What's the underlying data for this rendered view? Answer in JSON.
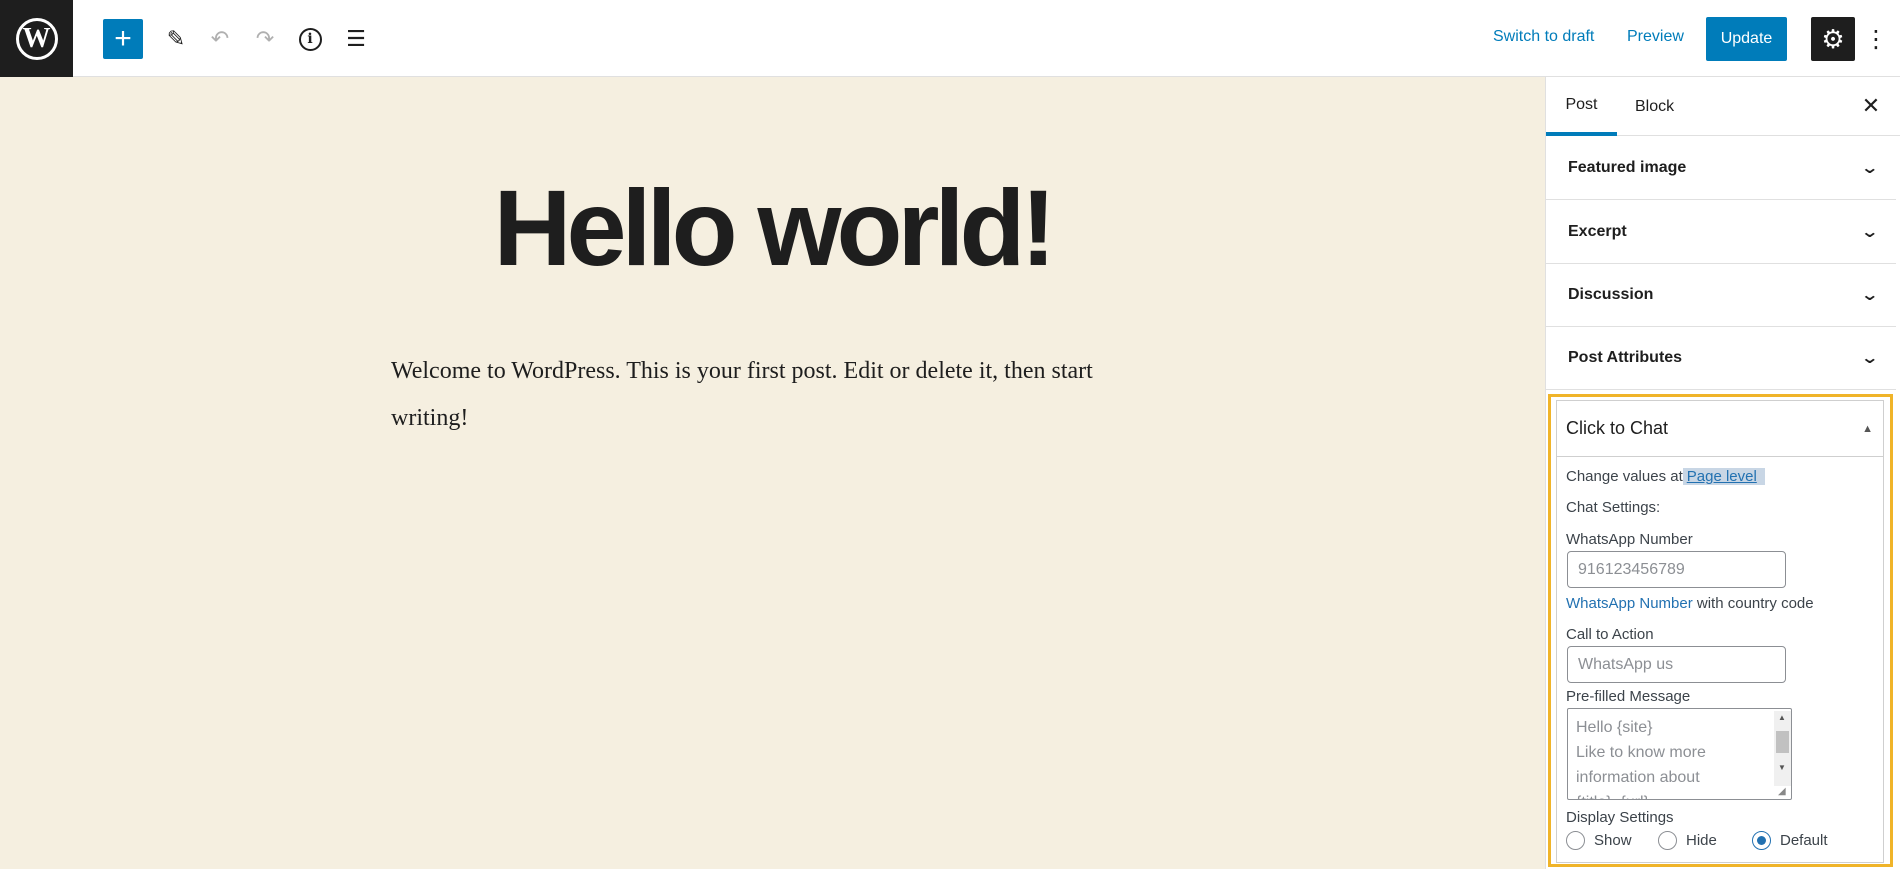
{
  "toolbar": {
    "logo_letter": "W",
    "add_icon": "+",
    "pen_icon": "✎",
    "undo_icon": "↶",
    "redo_icon": "↷",
    "info_icon": "i",
    "outline_icon": "☰",
    "switch_to_draft": "Switch to draft",
    "preview": "Preview",
    "update": "Update",
    "settings_icon": "⚙",
    "more_icon": "⋮"
  },
  "post": {
    "title": "Hello world!",
    "body": "Welcome to WordPress. This is your first post. Edit or delete it, then start writing!"
  },
  "sidebar": {
    "tabs": [
      {
        "label": "Post"
      },
      {
        "label": "Block"
      }
    ],
    "close_icon": "✕",
    "chevron": "⌄",
    "panels": [
      {
        "label": "Featured image"
      },
      {
        "label": "Excerpt"
      },
      {
        "label": "Discussion"
      },
      {
        "label": "Post Attributes"
      }
    ]
  },
  "click_to_chat": {
    "title": "Click to Chat",
    "collapse_icon": "▲",
    "change_values_prefix": "Change values at",
    "page_level_link": "Page level",
    "chat_settings_label": "Chat Settings:",
    "whatsapp_number_label": "WhatsApp Number",
    "whatsapp_number_placeholder": "916123456789",
    "whatsapp_number_help_link": "WhatsApp Number",
    "whatsapp_number_help_text": "with country code",
    "cta_label": "Call to Action",
    "cta_placeholder": "WhatsApp us",
    "prefilled_label": "Pre-filled Message",
    "prefilled_placeholder": "Hello {site}\nLike to know more information about\n{title}, {url}",
    "display_settings_label": "Display Settings",
    "display_options": [
      {
        "label": "Show",
        "checked": false
      },
      {
        "label": "Hide",
        "checked": false
      },
      {
        "label": "Default",
        "checked": true
      }
    ]
  }
}
